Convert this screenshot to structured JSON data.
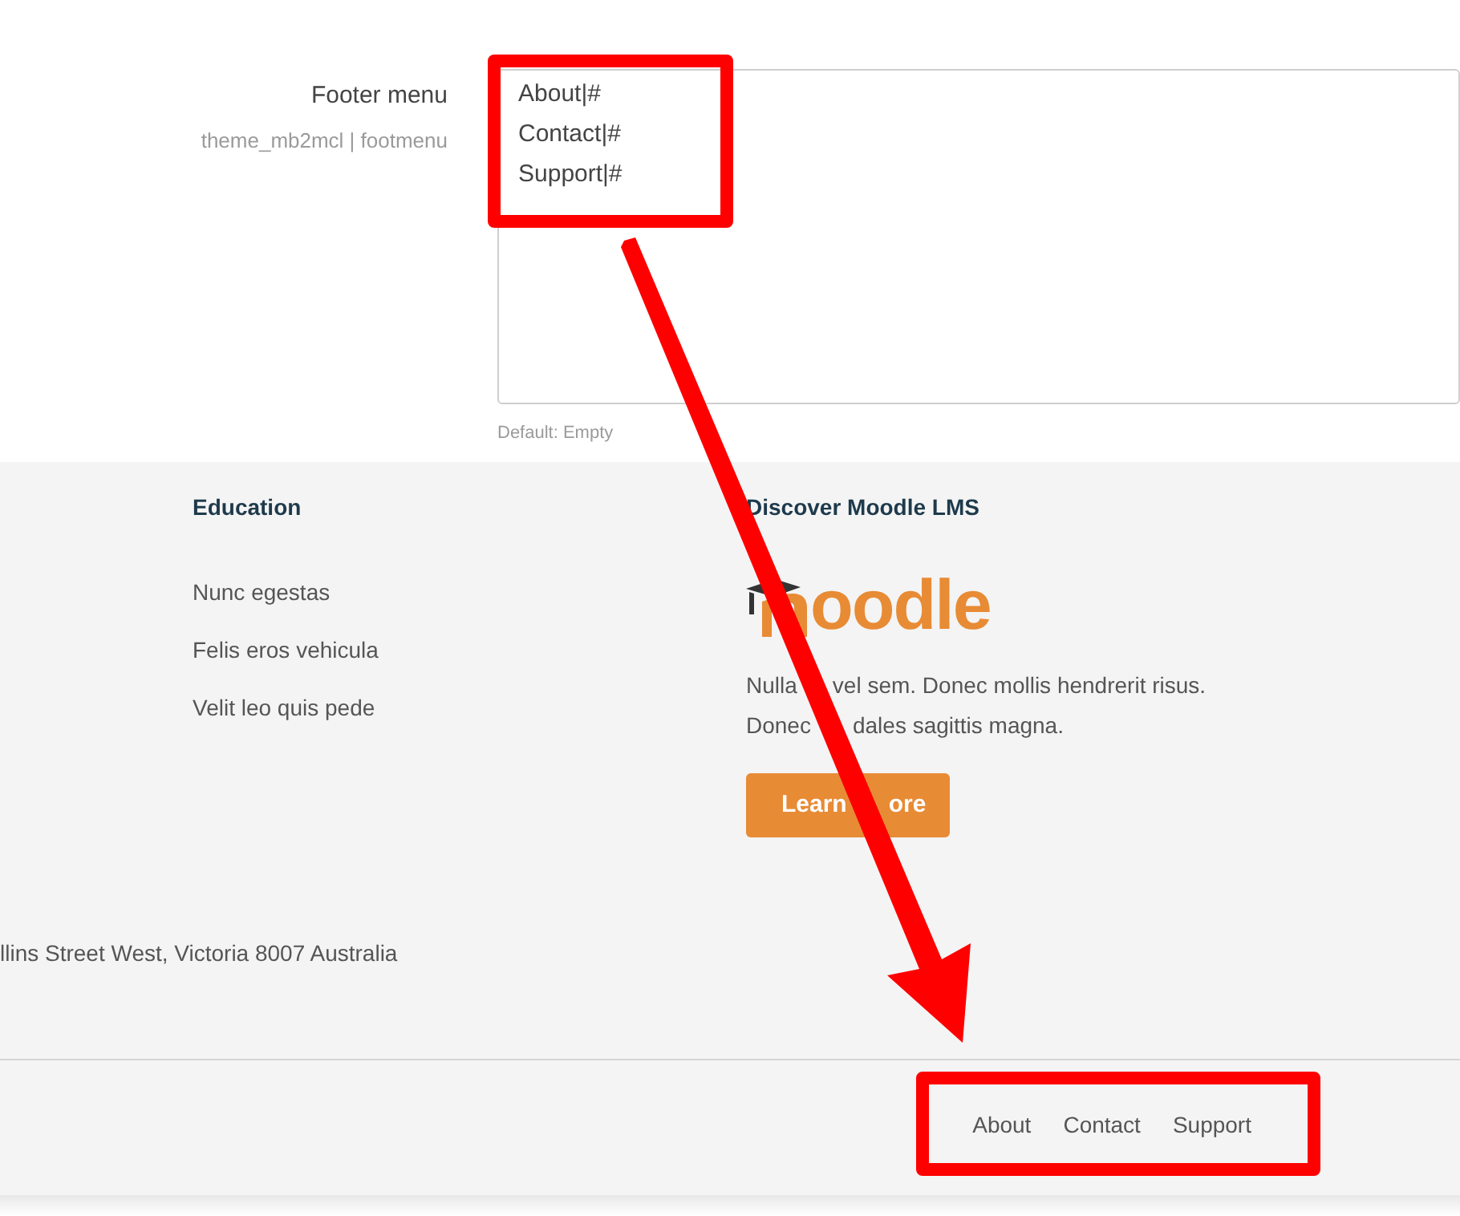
{
  "setting": {
    "label": "Footer menu",
    "key": "theme_mb2mcl | footmenu",
    "value_lines": [
      "About|#",
      "Contact|#",
      "Support|#"
    ],
    "default": "Default: Empty"
  },
  "footer": {
    "columns": [
      {
        "heading": "Education",
        "links": [
          "Nunc egestas",
          "Felis eros vehicula",
          "Velit leo quis pede"
        ]
      },
      {
        "heading": "Discover Moodle LMS",
        "logo": "oodle",
        "text": [
          [
            "Nulla",
            "vel sem. Donec mollis hendrerit risus."
          ],
          [
            "Donec",
            "dales sagittis magna."
          ]
        ],
        "button": [
          "Learn",
          "ore"
        ]
      }
    ],
    "address": "llins Street West, Victoria 8007 Australia",
    "menu": [
      "About",
      "Contact",
      "Support"
    ]
  },
  "annotations": [
    {
      "kind": "box"
    },
    {
      "kind": "arrow"
    },
    {
      "kind": "box"
    }
  ]
}
